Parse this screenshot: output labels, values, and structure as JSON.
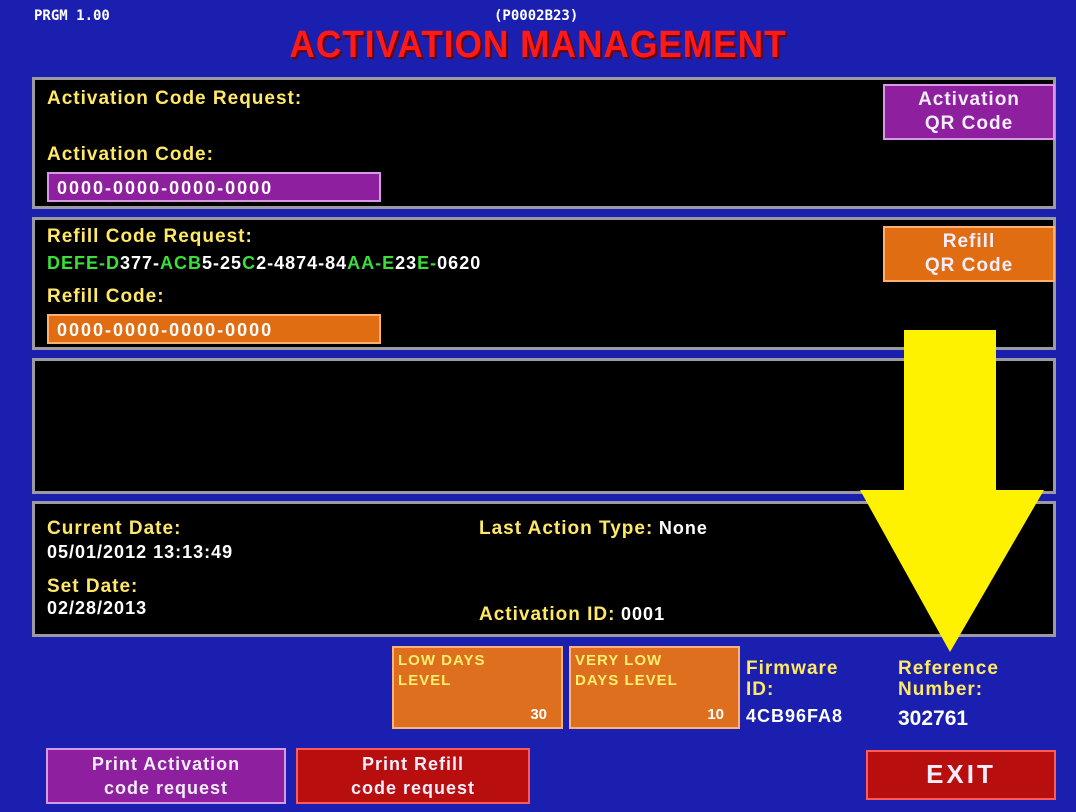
{
  "header": {
    "program_version": "PRGM 1.00",
    "program_id": "(P0002B23)",
    "title": "ACTIVATION MANAGEMENT"
  },
  "activation": {
    "request_label": "Activation Code Request:",
    "code_label": "Activation Code:",
    "code_value": "0000-0000-0000-0000",
    "qr_button_line1": "Activation",
    "qr_button_line2": "QR Code"
  },
  "refill": {
    "request_label": "Refill Code Request:",
    "request_segments": [
      {
        "text": "DEFE-D",
        "color": "green"
      },
      {
        "text": "377-",
        "color": "white"
      },
      {
        "text": "ACB",
        "color": "green"
      },
      {
        "text": "5-25",
        "color": "white"
      },
      {
        "text": "C",
        "color": "green"
      },
      {
        "text": "2-4874-84",
        "color": "white"
      },
      {
        "text": "AA-E",
        "color": "green"
      },
      {
        "text": "23",
        "color": "white"
      },
      {
        "text": "E-",
        "color": "green"
      },
      {
        "text": "0620",
        "color": "white"
      }
    ],
    "code_label": "Refill Code:",
    "code_value": "0000-0000-0000-0000",
    "qr_button_line1": "Refill",
    "qr_button_line2": "QR Code"
  },
  "status": {
    "current_date_label": "Current Date:",
    "current_date_value": "05/01/2012 13:13:49",
    "set_date_label": "Set Date:",
    "set_date_value": "02/28/2013",
    "last_action_label": "Last Action Type:",
    "last_action_value": "None",
    "activation_id_label": "Activation ID:",
    "activation_id_value": "0001"
  },
  "levels": {
    "low_days_line1": "LOW DAYS",
    "low_days_line2": "LEVEL",
    "low_days_value": "30",
    "very_low_line1": "VERY LOW",
    "very_low_line2": "DAYS LEVEL",
    "very_low_value": "10"
  },
  "firmware": {
    "label_line1": "Firmware",
    "label_line2": "ID:",
    "value": "4CB96FA8"
  },
  "reference": {
    "label_line1": "Reference",
    "label_line2": "Number:",
    "value": "302761"
  },
  "footer": {
    "print_activation_line1": "Print Activation",
    "print_activation_line2": "code request",
    "print_refill_line1": "Print Refill",
    "print_refill_line2": "code request",
    "exit_label": "EXIT"
  },
  "colors": {
    "background": "#1a1fb0",
    "title_red": "#ff1a1a",
    "label_yellow": "#ffe866",
    "code_green": "#3adf3a",
    "purple_button": "#8e1f9e",
    "orange_button": "#e06d12",
    "exit_red": "#b80e0e",
    "arrow_yellow": "#fff200"
  },
  "annotation": {
    "arrow_icon": "down-arrow-icon"
  }
}
